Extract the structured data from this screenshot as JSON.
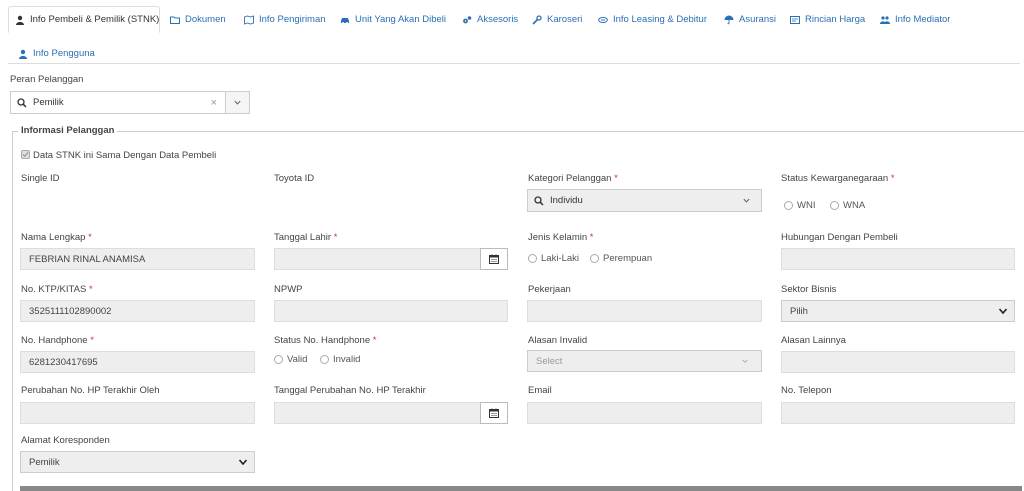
{
  "tabs": [
    {
      "label": "Info Pembeli & Pemilik (STNK)",
      "icon": "user-icon",
      "active": true
    },
    {
      "label": "Dokumen",
      "icon": "folder-icon"
    },
    {
      "label": "Info Pengiriman",
      "icon": "map-icon"
    },
    {
      "label": "Unit Yang Akan Dibeli",
      "icon": "car-icon"
    },
    {
      "label": "Aksesoris",
      "icon": "cogs-icon"
    },
    {
      "label": "Karoseri",
      "icon": "wrench-icon"
    },
    {
      "label": "Info Leasing & Debitur",
      "icon": "handshake-icon"
    },
    {
      "label": "Asuransi",
      "icon": "umbrella-icon"
    },
    {
      "label": "Rincian Harga",
      "icon": "list-box-icon"
    },
    {
      "label": "Info Mediator",
      "icon": "users-icon"
    },
    {
      "label": "Info Pengguna",
      "icon": "user-icon"
    }
  ],
  "peran": {
    "label": "Peran Pelanggan",
    "value": "Pemilik",
    "clear": "×"
  },
  "section": {
    "legend": "Informasi Pelanggan"
  },
  "same_as_buyer": {
    "label": "Data STNK ini Sama Dengan Data Pembeli"
  },
  "fields": {
    "single_id": {
      "label": "Single ID"
    },
    "toyota_id": {
      "label": "Toyota ID"
    },
    "kategori": {
      "label": "Kategori Pelanggan",
      "value": "Individu"
    },
    "status_kewarganegaraan": {
      "label": "Status Kewarganegaraan",
      "opt1": "WNI",
      "opt2": "WNA"
    },
    "nama": {
      "label": "Nama Lengkap",
      "value": "FEBRIAN RINAL ANAMISA"
    },
    "tgl_lahir": {
      "label": "Tanggal Lahir"
    },
    "jenis_kelamin": {
      "label": "Jenis Kelamin",
      "opt1": "Laki-Laki",
      "opt2": "Perempuan"
    },
    "hubungan": {
      "label": "Hubungan Dengan Pembeli"
    },
    "ktp": {
      "label": "No. KTP/KITAS",
      "value": "3525111102890002"
    },
    "npwp": {
      "label": "NPWP"
    },
    "pekerjaan": {
      "label": "Pekerjaan"
    },
    "sektor": {
      "label": "Sektor Bisnis",
      "value": "Pilih"
    },
    "hp": {
      "label": "No. Handphone",
      "value": "6281230417695"
    },
    "status_hp": {
      "label": "Status No. Handphone",
      "opt1": "Valid",
      "opt2": "Invalid"
    },
    "alasan_invalid": {
      "label": "Alasan Invalid",
      "placeholder": "Select"
    },
    "alasan_lain": {
      "label": "Alasan Lainnya"
    },
    "perubahan_hp": {
      "label": "Perubahan No. HP Terakhir Oleh"
    },
    "tgl_perubahan": {
      "label": "Tanggal Perubahan No. HP Terakhir"
    },
    "email": {
      "label": "Email"
    },
    "telepon": {
      "label": "No. Telepon"
    },
    "alamat": {
      "label": "Alamat Koresponden",
      "value": "Pemilik"
    }
  },
  "required_mark": "*"
}
